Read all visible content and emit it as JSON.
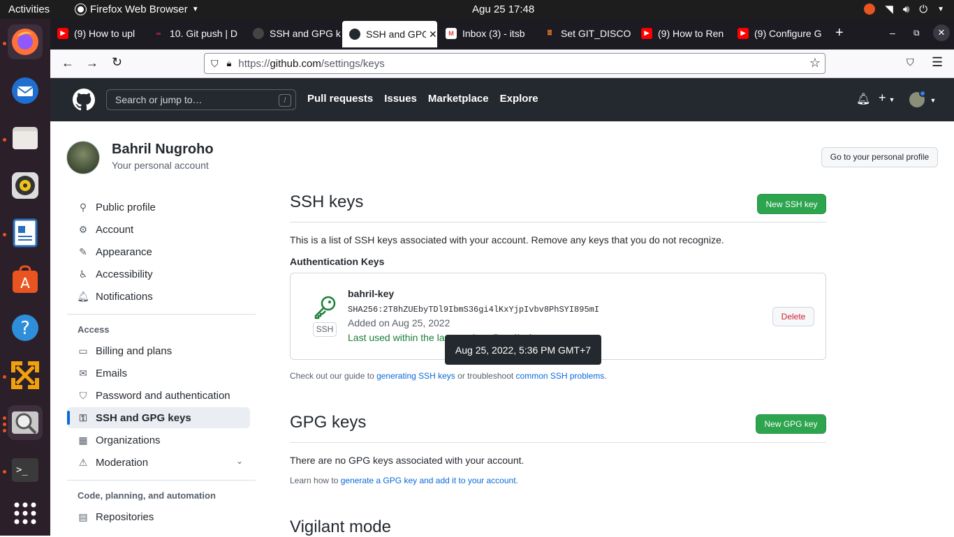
{
  "os": {
    "activities": "Activities",
    "app_name": "Firefox Web Browser",
    "clock": "Agu 25  17:48"
  },
  "browser": {
    "tabs": [
      {
        "label": "(9) How to upl",
        "icon": "youtube-icon",
        "color": "#ff0000"
      },
      {
        "label": "10. Git push | D",
        "icon": "site-icon",
        "color": "#e0245e"
      },
      {
        "label": "SSH and GPG k",
        "icon": "github-icon",
        "color": "#24292f"
      },
      {
        "label": "SSH and GPG",
        "icon": "github-icon",
        "color": "#24292f"
      },
      {
        "label": "Inbox (3) - itsb",
        "icon": "gmail-icon",
        "color": "#ea4335"
      },
      {
        "label": "Set GIT_DISCO",
        "icon": "stackoverflow-icon",
        "color": "#f48024"
      },
      {
        "label": "(9) How to Ren",
        "icon": "youtube-icon",
        "color": "#ff0000"
      },
      {
        "label": "(9) Configure G",
        "icon": "youtube-icon",
        "color": "#ff0000"
      }
    ],
    "url_prefix": "https://",
    "url_domain": "github.com",
    "url_path": "/settings/keys"
  },
  "github": {
    "search_placeholder": "Search or jump to…",
    "search_shortcut": "/",
    "nav": [
      "Pull requests",
      "Issues",
      "Marketplace",
      "Explore"
    ]
  },
  "profile": {
    "name": "Bahril Nugroho",
    "subtitle": "Your personal account",
    "go_profile": "Go to your personal profile"
  },
  "sidebar": {
    "items": [
      {
        "label": "Public profile",
        "icon": "person-icon"
      },
      {
        "label": "Account",
        "icon": "gear-icon"
      },
      {
        "label": "Appearance",
        "icon": "paintbrush-icon"
      },
      {
        "label": "Accessibility",
        "icon": "accessibility-icon"
      },
      {
        "label": "Notifications",
        "icon": "bell-icon"
      }
    ],
    "access_header": "Access",
    "access_items": [
      {
        "label": "Billing and plans",
        "icon": "credit-card-icon"
      },
      {
        "label": "Emails",
        "icon": "mail-icon"
      },
      {
        "label": "Password and authentication",
        "icon": "shield-icon"
      },
      {
        "label": "SSH and GPG keys",
        "icon": "key-icon"
      },
      {
        "label": "Organizations",
        "icon": "organization-icon"
      },
      {
        "label": "Moderation",
        "icon": "report-icon"
      }
    ],
    "code_header": "Code, planning, and automation",
    "code_items": [
      {
        "label": "Repositories",
        "icon": "repo-icon"
      }
    ]
  },
  "ssh": {
    "title": "SSH keys",
    "new_button": "New SSH key",
    "description": "This is a list of SSH keys associated with your account. Remove any keys that you do not recognize.",
    "auth_header": "Authentication Keys",
    "key": {
      "name": "bahril-key",
      "fingerprint": "SHA256:2T8hZUEbyTDl9IbmS36gi4lKxYjpIvbv8PhSYI895mI",
      "added": "Added on Aug 25, 2022",
      "last_used": "Last used within the last week — Read/write",
      "badge": "SSH",
      "delete": "Delete"
    },
    "tooltip": "Aug 25, 2022, 5:36 PM GMT+7",
    "guide_prefix": "Check out our guide to ",
    "guide_link1": "generating SSH keys",
    "guide_mid": " or troubleshoot ",
    "guide_link2": "common SSH problems",
    "guide_suffix": "."
  },
  "gpg": {
    "title": "GPG keys",
    "new_button": "New GPG key",
    "none_text": "There are no GPG keys associated with your account.",
    "learn_prefix": "Learn how to ",
    "learn_link": "generate a GPG key and add it to your account",
    "learn_suffix": "."
  },
  "vigilant": {
    "title": "Vigilant mode"
  },
  "colors": {
    "accent_green": "#2da44e",
    "link_blue": "#0969da",
    "danger_red": "#cf222e",
    "header_dark": "#24292f"
  }
}
